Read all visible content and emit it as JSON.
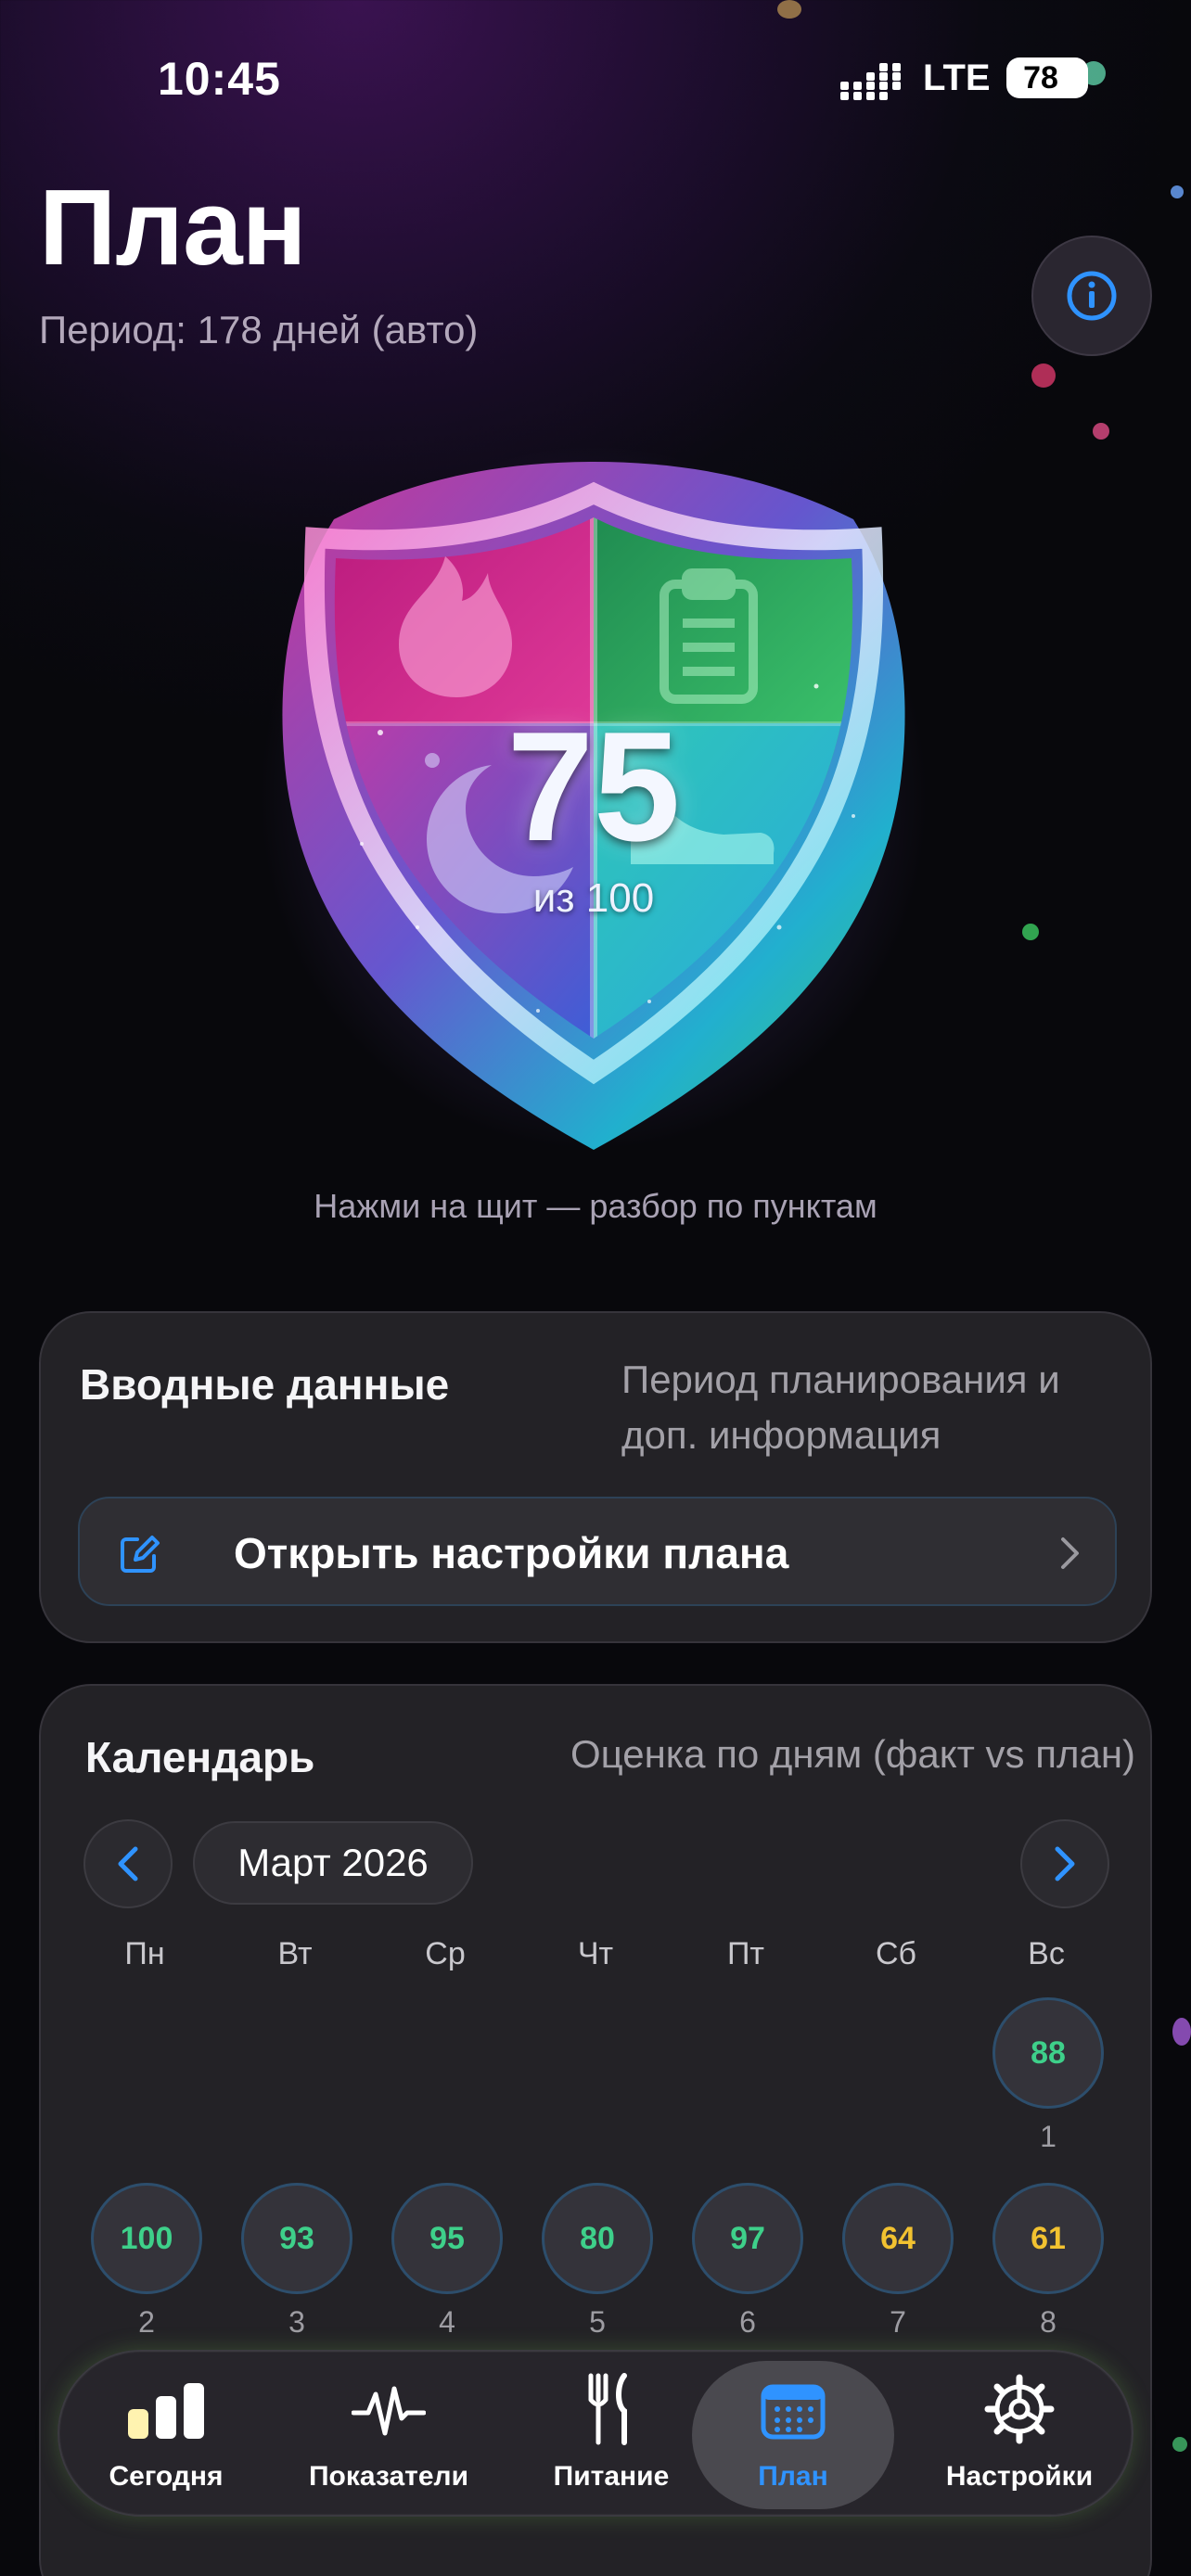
{
  "status": {
    "time": "10:45",
    "network": "LTE",
    "battery": "78"
  },
  "header": {
    "title": "План",
    "subtitle": "Период: 178 дней (авто)"
  },
  "shield": {
    "score": "75",
    "out_of": "из 100",
    "hint": "Нажми на щит — разбор по пунктам"
  },
  "input_card": {
    "title": "Вводные данные",
    "description": "Период планирования и доп. информация",
    "button_label": "Открыть настройки плана"
  },
  "calendar": {
    "title": "Календарь",
    "description": "Оценка по дням (факт vs план)",
    "month": "Март 2026",
    "weekdays": [
      "Пн",
      "Вт",
      "Ср",
      "Чт",
      "Пт",
      "Сб",
      "Вс"
    ],
    "days": [
      {
        "day": "1",
        "score": "88",
        "level": "green"
      },
      {
        "day": "2",
        "score": "100",
        "level": "green"
      },
      {
        "day": "3",
        "score": "93",
        "level": "green"
      },
      {
        "day": "4",
        "score": "95",
        "level": "green"
      },
      {
        "day": "5",
        "score": "80",
        "level": "green"
      },
      {
        "day": "6",
        "score": "97",
        "level": "green"
      },
      {
        "day": "7",
        "score": "64",
        "level": "yellow"
      },
      {
        "day": "8",
        "score": "61",
        "level": "yellow"
      }
    ]
  },
  "tabs": [
    {
      "label": "Сегодня",
      "icon": "bar-chart-icon"
    },
    {
      "label": "Показатели",
      "icon": "pulse-icon"
    },
    {
      "label": "Питание",
      "icon": "fork-knife-icon"
    },
    {
      "label": "План",
      "icon": "calendar-icon",
      "active": true
    },
    {
      "label": "Настройки",
      "icon": "gear-icon"
    }
  ],
  "colors": {
    "accent": "#2f93ff",
    "good": "#3ed08a",
    "warn": "#f2c230"
  }
}
